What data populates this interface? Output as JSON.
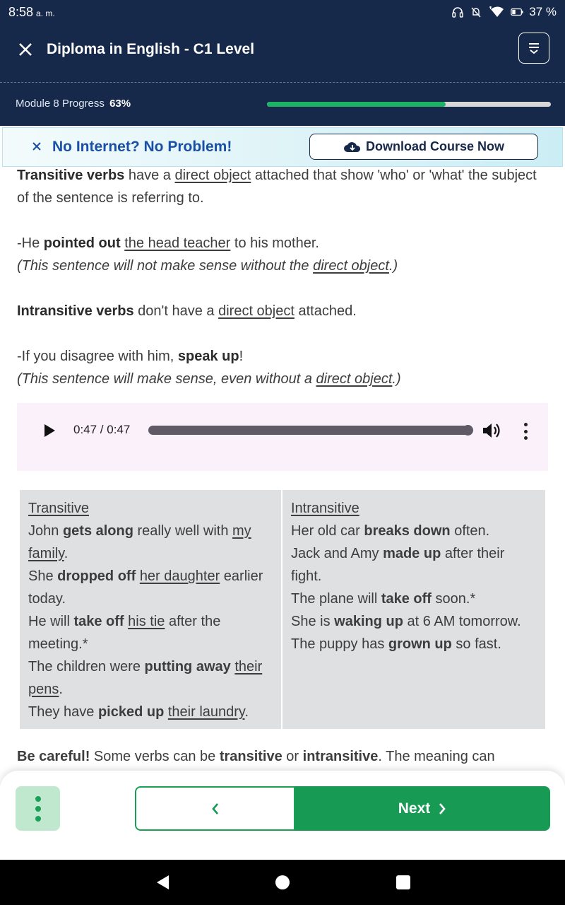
{
  "status_bar": {
    "time": "8:58",
    "ampm": "a. m.",
    "battery": "37 %"
  },
  "header": {
    "title": "Diploma in English - C1 Level",
    "progress_label": "Module 8 Progress",
    "progress_value": "63%",
    "progress_fraction": 0.63
  },
  "banner": {
    "text": "No Internet? No Problem!",
    "download_label": "Download Course Now"
  },
  "content": {
    "p1": [
      {
        "t": "Transitive verbs",
        "s": "b"
      },
      {
        "t": " have a ",
        "s": ""
      },
      {
        "t": "direct object",
        "s": "u"
      },
      {
        "t": " attached that show  'who' or 'what' the subject of the sentence is referring to.",
        "s": ""
      }
    ],
    "p2_line1": [
      {
        "t": "-He ",
        "s": ""
      },
      {
        "t": "pointed out",
        "s": "b"
      },
      {
        "t": " ",
        "s": ""
      },
      {
        "t": "the head teacher",
        "s": "u"
      },
      {
        "t": " to his mother.",
        "s": ""
      }
    ],
    "p2_line2": [
      {
        "t": "(This sentence will not make sense without the ",
        "s": "i"
      },
      {
        "t": "direct object",
        "s": "iu"
      },
      {
        "t": ".)",
        "s": "i"
      }
    ],
    "p3": [
      {
        "t": "Intransitive verbs",
        "s": "b"
      },
      {
        "t": " don't have a ",
        "s": ""
      },
      {
        "t": "direct object",
        "s": "u"
      },
      {
        "t": " attached.",
        "s": ""
      }
    ],
    "p4_line1": [
      {
        "t": "-If you disagree with him, ",
        "s": ""
      },
      {
        "t": "speak up",
        "s": "b"
      },
      {
        "t": "!",
        "s": ""
      }
    ],
    "p4_line2": [
      {
        "t": "(This sentence will make sense, even without a ",
        "s": "i"
      },
      {
        "t": "direct object",
        "s": "iu"
      },
      {
        "t": ".)",
        "s": "i"
      }
    ]
  },
  "audio": {
    "time": "0:47 / 0:47",
    "progress_fraction": 1.0
  },
  "table": {
    "col1": [
      [
        {
          "t": "Transitive",
          "s": "u"
        }
      ],
      [
        {
          "t": "John ",
          "s": ""
        },
        {
          "t": "gets along",
          "s": "b"
        },
        {
          "t": " really well with ",
          "s": ""
        },
        {
          "t": "my family",
          "s": "u"
        },
        {
          "t": ".",
          "s": ""
        }
      ],
      [
        {
          "t": "She ",
          "s": ""
        },
        {
          "t": "dropped off",
          "s": "b"
        },
        {
          "t": " ",
          "s": ""
        },
        {
          "t": "her daughter",
          "s": "u"
        },
        {
          "t": " earlier today.",
          "s": ""
        }
      ],
      [
        {
          "t": "He will ",
          "s": ""
        },
        {
          "t": "take off",
          "s": "b"
        },
        {
          "t": " ",
          "s": ""
        },
        {
          "t": "his tie",
          "s": "u"
        },
        {
          "t": " after the meeting.*",
          "s": ""
        }
      ],
      [
        {
          "t": "The children were ",
          "s": ""
        },
        {
          "t": "putting away",
          "s": "b"
        },
        {
          "t": " ",
          "s": ""
        },
        {
          "t": "their pens",
          "s": "u"
        },
        {
          "t": ".",
          "s": ""
        }
      ],
      [
        {
          "t": "They have ",
          "s": ""
        },
        {
          "t": "picked up",
          "s": "b"
        },
        {
          "t": " ",
          "s": ""
        },
        {
          "t": "their laundry",
          "s": "u"
        },
        {
          "t": ".",
          "s": ""
        }
      ]
    ],
    "col2": [
      [
        {
          "t": "Intransitive",
          "s": "u"
        }
      ],
      [
        {
          "t": "Her old car ",
          "s": ""
        },
        {
          "t": "breaks down",
          "s": "b"
        },
        {
          "t": " often.",
          "s": ""
        }
      ],
      [
        {
          "t": "Jack and Amy ",
          "s": ""
        },
        {
          "t": "made up",
          "s": "b"
        },
        {
          "t": " after their fight.",
          "s": ""
        }
      ],
      [
        {
          "t": "The plane will ",
          "s": ""
        },
        {
          "t": "take off",
          "s": "b"
        },
        {
          "t": " soon.*",
          "s": ""
        }
      ],
      [
        {
          "t": "She is ",
          "s": ""
        },
        {
          "t": "waking up",
          "s": "b"
        },
        {
          "t": " at 6 AM tomorrow.",
          "s": ""
        }
      ],
      [
        {
          "t": "The puppy has ",
          "s": ""
        },
        {
          "t": "grown up",
          "s": "b"
        },
        {
          "t": " so fast.",
          "s": ""
        }
      ]
    ]
  },
  "careful": [
    {
      "t": "Be careful!",
      "s": "b"
    },
    {
      "t": " Some verbs can be ",
      "s": ""
    },
    {
      "t": "transitive",
      "s": "b"
    },
    {
      "t": " or ",
      "s": ""
    },
    {
      "t": "intransitive",
      "s": "b"
    },
    {
      "t": ". The meaning can",
      "s": ""
    }
  ],
  "bottom": {
    "next_label": "Next"
  },
  "colors": {
    "header_bg": "#16294a",
    "progress_fill": "#1db364",
    "banner_text": "#1a4fa6",
    "next_bg": "#169a54"
  },
  "icons": {
    "close": "close-icon",
    "menu": "expand-menu-icon",
    "banner_close": "close-icon",
    "download": "cloud-download-icon",
    "play": "play-icon",
    "volume": "volume-icon",
    "more": "more-vertical-icon",
    "prev": "chevron-left-icon",
    "next": "chevron-right-icon"
  }
}
